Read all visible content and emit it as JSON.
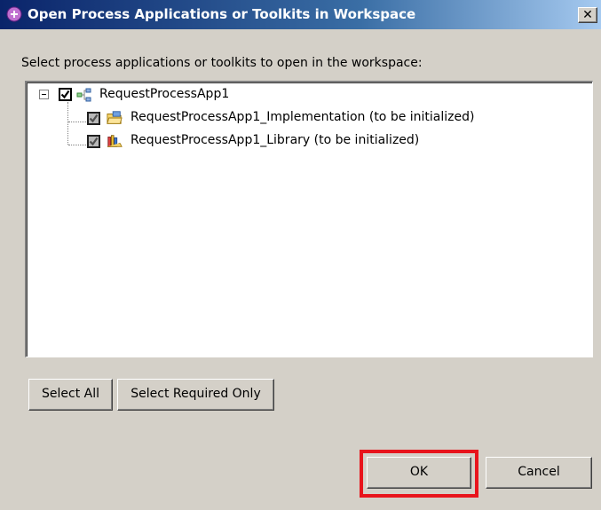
{
  "window": {
    "title": "Open Process Applications or Toolkits in Workspace",
    "close_glyph": "✕",
    "title_icon": "process-app-icon"
  },
  "instruction": "Select process applications or toolkits to open in the workspace:",
  "tree": {
    "root": {
      "label": "RequestProcessApp1",
      "checked": true,
      "expanded": true,
      "icon": "process-app-tree-icon"
    },
    "children": [
      {
        "label": "RequestProcessApp1_Implementation (to be initialized)",
        "checked": true,
        "greyed": true,
        "icon": "implementation-folder-icon"
      },
      {
        "label": "RequestProcessApp1_Library (to be initialized)",
        "checked": true,
        "greyed": true,
        "icon": "library-icon"
      }
    ]
  },
  "buttons": {
    "select_all": "Select All",
    "select_required": "Select Required Only",
    "ok": "OK",
    "cancel": "Cancel"
  },
  "colors": {
    "dialog_bg": "#d4d0c8",
    "title_gradient_start": "#0a246a",
    "highlight": "#e8141c"
  }
}
